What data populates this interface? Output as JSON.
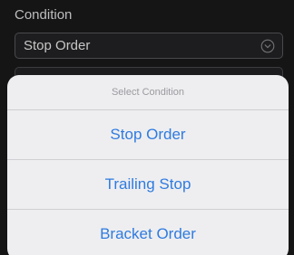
{
  "field": {
    "label": "Condition",
    "selected_value": "Stop Order"
  },
  "icons": {
    "dropdown": "chevron-down-circle-icon"
  },
  "colors": {
    "background": "#1a1a1c",
    "sheet": "#eeeef0",
    "accent": "#2f7be0",
    "header_text": "#9a9aa0"
  },
  "picker": {
    "title": "Select Condition",
    "options": [
      {
        "label": "Stop Order"
      },
      {
        "label": "Trailing Stop"
      },
      {
        "label": "Bracket Order"
      }
    ]
  }
}
